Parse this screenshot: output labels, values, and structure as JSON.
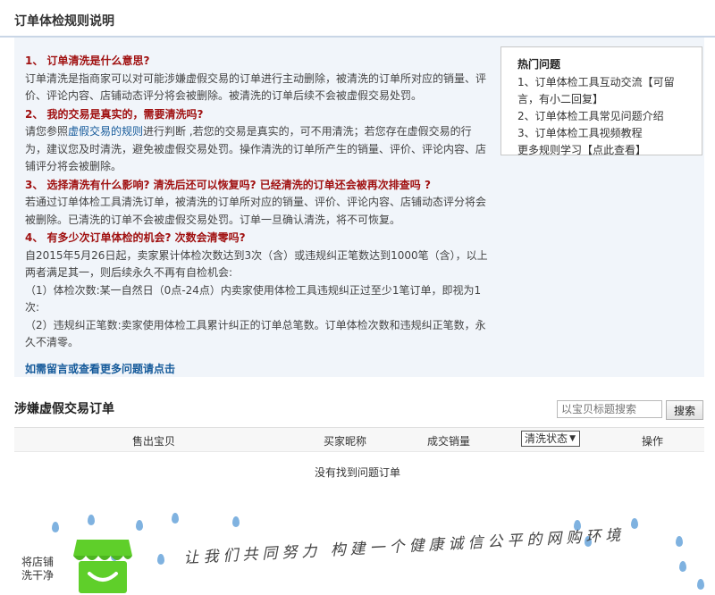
{
  "header": {
    "title": "订单体检规则说明"
  },
  "rules": [
    {
      "question": "1、 订单清洗是什么意思?",
      "answer": "订单清洗是指商家可以对可能涉嫌虚假交易的订单进行主动删除，被清洗的订单所对应的销量、评价、评论内容、店铺动态评分将会被删除。被清洗的订单后续不会被虚假交易处罚。"
    },
    {
      "question": "2、 我的交易是真实的，需要清洗吗?",
      "answer_before_link": "请您参照",
      "answer_link": "虚假交易的规则",
      "answer_after_link": "进行判断 ,若您的交易是真实的，可不用清洗；若您存在虚假交易的行为，建议您及时清洗，避免被虚假交易处罚。操作清洗的订单所产生的销量、评价、评论内容、店铺评分将会被删除。"
    },
    {
      "question": "3、 选择清洗有什么影响? 清洗后还可以恢复吗? 已经清洗的订单还会被再次排查吗 ?",
      "answer": "若通过订单体检工具清洗订单，被清洗的订单所对应的销量、评价、评论内容、店铺动态评分将会被删除。已清洗的订单不会被虚假交易处罚。订单一旦确认清洗，将不可恢复。"
    },
    {
      "question": "4、 有多少次订单体检的机会? 次数会清零吗?",
      "answer": "自2015年5月26日起，卖家累计体检次数达到3次（含）或违规纠正笔数达到1000笔（含），以上两者满足其一，则后续永久不再有自检机会:",
      "answer_line2": "（1）体检次数:某一自然日（0点-24点）内卖家使用体检工具违规纠正过至少1笔订单，即视为1次:",
      "answer_line3": "（2）违规纠正笔数:卖家使用体检工具累计纠正的订单总笔数。订单体检次数和违规纠正笔数，永久不清零。"
    }
  ],
  "more_link": "如需留言或查看更多问题请点击",
  "hot": {
    "title": "热门问题",
    "items": [
      "1、订单体检工具互动交流【可留言，有小二回复】",
      "2、订单体检工具常见问题介绍",
      "3、订单体检工具视频教程",
      "更多规则学习【点此查看】"
    ]
  },
  "orders": {
    "title": "涉嫌虚假交易订单",
    "search_placeholder": "以宝贝标题搜索",
    "search_button": "搜索",
    "columns": [
      "售出宝贝",
      "买家昵称",
      "成交销量",
      "清洗状态",
      "操作"
    ],
    "empty_message": "没有找到问题订单"
  },
  "footer": {
    "store_label_1": "将店铺",
    "store_label_2": "洗干净",
    "slogan": "让我们共同努力 构建一个健康诚信公平的网购环境"
  },
  "colors": {
    "question_red": "#a01010",
    "link_blue": "#155a9a",
    "panel_bg": "#f1f5fa",
    "store_green": "#5fcf2a"
  }
}
